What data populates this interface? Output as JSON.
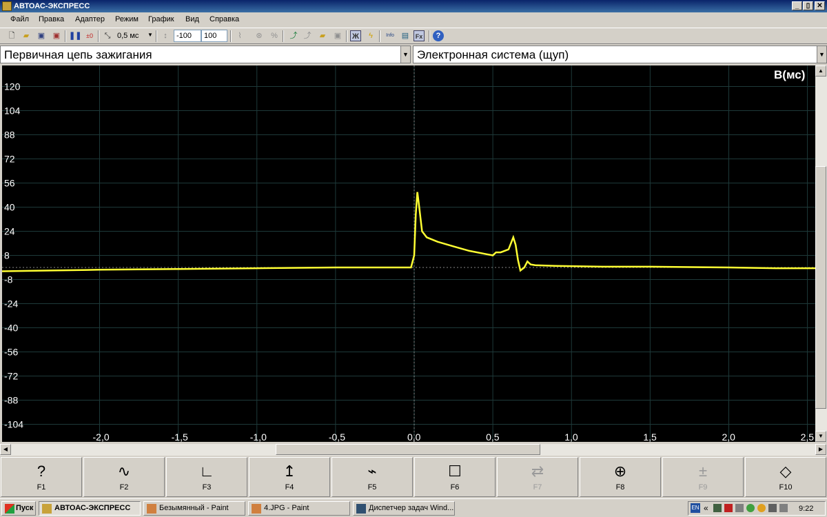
{
  "window": {
    "title": "АВТОАС-ЭКСПРЕСС",
    "min": "_",
    "max": "▯",
    "close": "✕"
  },
  "menu": [
    "Файл",
    "Правка",
    "Адаптер",
    "Режим",
    "График",
    "Вид",
    "Справка"
  ],
  "toolbar": {
    "timebase": "0,5 мс",
    "y_min": "-100",
    "y_max": "100",
    "mode_bold": "Ж",
    "info_label": "Info",
    "fx_label": "Fx"
  },
  "combos": {
    "left": "Первичная цепь зажигания",
    "right": "Электронная система (щуп)"
  },
  "chart_data": {
    "type": "line",
    "unit_label": "В(мс)",
    "x_ticks": [
      "-2,0",
      "-1,5",
      "-1,0",
      "-0,5",
      "0,0",
      "0,5",
      "1,0",
      "1,5",
      "2,0",
      "2,5"
    ],
    "y_ticks": [
      "120",
      "104",
      "88",
      "72",
      "56",
      "40",
      "24",
      "8",
      "-8",
      "-24",
      "-40",
      "-56",
      "-72",
      "-88",
      "-104"
    ],
    "xlim": [
      -2.62,
      2.55
    ],
    "ylim": [
      -112,
      128
    ],
    "grid": true,
    "color": "#ffff33",
    "series": [
      {
        "points": [
          [
            -2.62,
            -2.5
          ],
          [
            -2.3,
            -2
          ],
          [
            -2.0,
            -1.5
          ],
          [
            -1.5,
            -1
          ],
          [
            -1.0,
            -0.5
          ],
          [
            -0.5,
            0
          ],
          [
            -0.02,
            0
          ],
          [
            0.0,
            8
          ],
          [
            0.01,
            35
          ],
          [
            0.02,
            50
          ],
          [
            0.03,
            42
          ],
          [
            0.05,
            24
          ],
          [
            0.08,
            20
          ],
          [
            0.15,
            17
          ],
          [
            0.25,
            14
          ],
          [
            0.35,
            11
          ],
          [
            0.45,
            9
          ],
          [
            0.5,
            8
          ],
          [
            0.52,
            10
          ],
          [
            0.55,
            10
          ],
          [
            0.6,
            12
          ],
          [
            0.63,
            20
          ],
          [
            0.645,
            15
          ],
          [
            0.66,
            5
          ],
          [
            0.675,
            -2
          ],
          [
            0.7,
            0
          ],
          [
            0.72,
            4
          ],
          [
            0.74,
            2
          ],
          [
            0.77,
            1.5
          ],
          [
            0.9,
            1
          ],
          [
            1.2,
            0.5
          ],
          [
            1.5,
            0.5
          ],
          [
            2.0,
            0
          ],
          [
            2.3,
            -0.5
          ],
          [
            2.55,
            -0.5
          ]
        ]
      }
    ]
  },
  "fkeys": [
    {
      "icon": "?",
      "label": "F1",
      "name": "help",
      "enabled": true
    },
    {
      "icon": "∿",
      "label": "F2",
      "name": "signal",
      "enabled": true
    },
    {
      "icon": "∟",
      "label": "F3",
      "name": "axis-x",
      "enabled": true
    },
    {
      "icon": "↥",
      "label": "F4",
      "name": "axis-y",
      "enabled": true
    },
    {
      "icon": "⌁",
      "label": "F5",
      "name": "probe",
      "enabled": true
    },
    {
      "icon": "☐",
      "label": "F6",
      "name": "stop",
      "enabled": true
    },
    {
      "icon": "⇄",
      "label": "F7",
      "name": "swap",
      "enabled": false
    },
    {
      "icon": "⊕",
      "label": "F8",
      "name": "cursor",
      "enabled": true
    },
    {
      "icon": "±",
      "label": "F9",
      "name": "offset",
      "enabled": false
    },
    {
      "icon": "◇",
      "label": "F10",
      "name": "exit",
      "enabled": true
    }
  ],
  "taskbar": {
    "start": "Пуск",
    "tasks": [
      "АВТОАС-ЭКСПРЕСС",
      "Безымянный - Paint",
      "4.JPG - Paint",
      "Диспетчер задач Wind..."
    ],
    "lang": "EN",
    "chevron": "«",
    "clock": "9:22"
  }
}
